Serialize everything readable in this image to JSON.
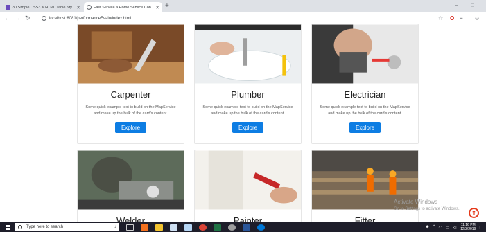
{
  "browser": {
    "tabs": [
      {
        "title": "30 Simple CSS3 & HTML Table Sty",
        "active": false
      },
      {
        "title": "Fast Service a Home Service Con",
        "active": true
      }
    ],
    "new_tab_label": "+",
    "window_controls": {
      "minimize": "–",
      "maximize": "□"
    },
    "nav": {
      "back": "←",
      "forward": "→",
      "reload": "↻"
    },
    "address": "localhost:8081/performanceEvalu/index.html",
    "toolbar_icons": [
      "bookmark-star-icon",
      "opera-icon",
      "extension-icon",
      "profile-icon"
    ]
  },
  "cards": [
    {
      "title": "Carpenter",
      "text": "Some quick example text to build on the MapService and make up the bulk of the card's content.",
      "button": "Explore",
      "image": "carpenter-photo"
    },
    {
      "title": "Plumber",
      "text": "Some quick example text to build on the MapService and make up the bulk of the card's content.",
      "button": "Explore",
      "image": "plumber-photo"
    },
    {
      "title": "Electrician",
      "text": "Some quick example text to build on the MapService and make up the bulk of the card's content.",
      "button": "Explore",
      "image": "electrician-photo"
    },
    {
      "title": "Welder",
      "image": "welder-photo"
    },
    {
      "title": "Painter",
      "image": "painter-photo"
    },
    {
      "title": "Fitter",
      "image": "fitter-photo"
    }
  ],
  "watermark": {
    "line1": "Activate Windows",
    "line2": "Go to Settings to activate Windows."
  },
  "back_to_top": "⇧",
  "taskbar": {
    "search_placeholder": "Type here to search",
    "apps": [
      "task-view-icon",
      "firefox-icon",
      "file-explorer-icon",
      "mail-icon",
      "store-icon",
      "chrome-icon",
      "excel-icon",
      "settings-icon",
      "word-icon",
      "edge-icon"
    ],
    "time": "11:16 PM",
    "date": "12/3/2019"
  },
  "colors": {
    "button": "#0d7de3",
    "back_to_top": "#e5391a",
    "taskbar": "#1e1e2a"
  }
}
